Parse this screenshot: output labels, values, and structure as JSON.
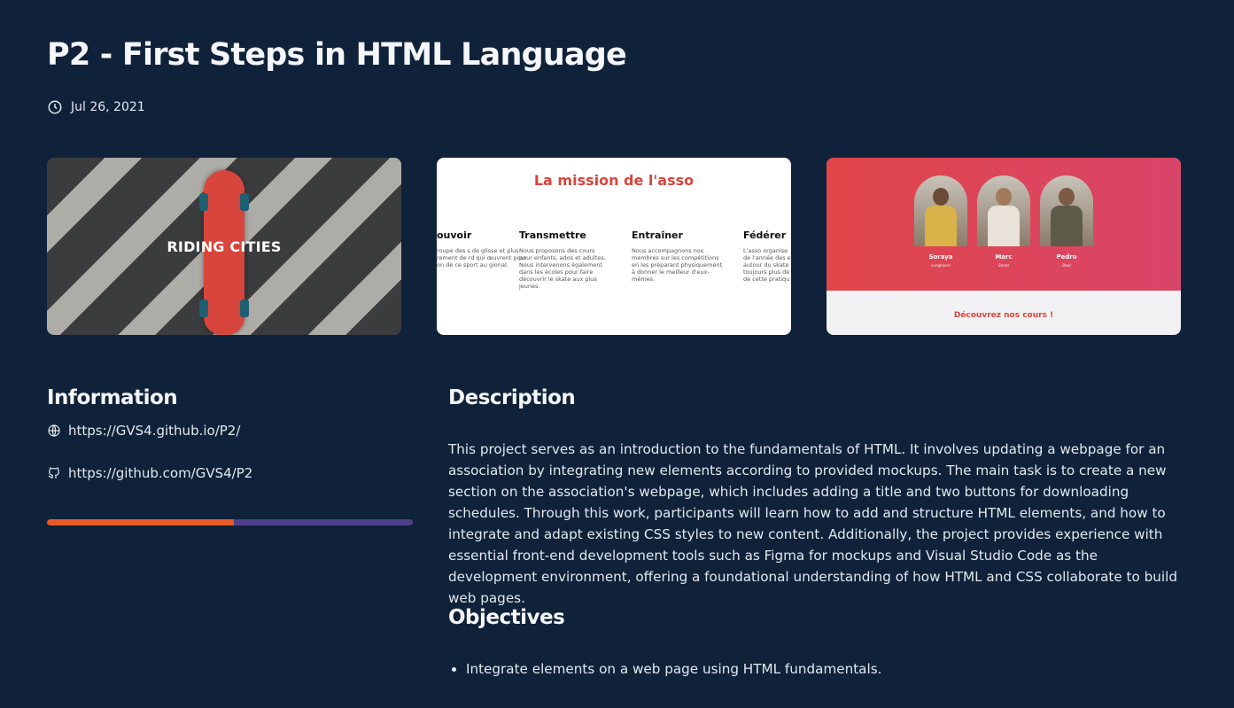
{
  "project": {
    "title": "P2 - First Steps in HTML Language",
    "date": "Jul 26, 2021"
  },
  "thumbnails": {
    "first": {
      "brand": "RIDING CITIES"
    },
    "second": {
      "heading": "La mission de l'asso",
      "columns": [
        {
          "title": "ouvoir",
          "text": "roupe des s de glisse et plus rement de rd qui œuvrent pour on de ce sport au gional."
        },
        {
          "title": "Transmettre",
          "text": "Nous proposons des cours pour enfants, ados et adultes. Nous intervenons également dans les écoles pour faire découvrir le skate aux plus jeunes."
        },
        {
          "title": "Entraîner",
          "text": "Nous accompagnons nos membres sur les compétitions en les préparant physiquement à donner le meilleur d'eux-mêmes."
        },
        {
          "title": "Fédérer",
          "text": "L'asso organise de l'année des e autour du skate toujours plus de de cette pratiqu"
        }
      ]
    },
    "third": {
      "people": [
        {
          "name": "Soraya",
          "role": "Longboard"
        },
        {
          "name": "Marc",
          "role": "Street"
        },
        {
          "name": "Pedro",
          "role": "Bowl"
        }
      ],
      "cta": "Découvrez nos cours !"
    }
  },
  "information": {
    "title": "Information",
    "website": "https://GVS4.github.io/P2/",
    "repository": "https://github.com/GVS4/P2",
    "progress_fraction": 0.51,
    "progress_colors": {
      "filled": "#ea5a25",
      "rest": "#4f3f88"
    }
  },
  "description": {
    "title": "Description",
    "text": "This project serves as an introduction to the fundamentals of HTML. It involves updating a webpage for an association by integrating new elements according to provided mockups. The main task is to create a new section on the association's webpage, which includes adding a title and two buttons for downloading schedules. Through this work, participants will learn how to add and structure HTML elements, and how to integrate and adapt existing CSS styles to new content. Additionally, the project provides experience with essential front-end development tools such as Figma for mockups and Visual Studio Code as the development environment, offering a foundational understanding of how HTML and CSS collaborate to build web pages."
  },
  "objectives": {
    "title": "Objectives",
    "items": [
      "Integrate elements on a web page using HTML fundamentals."
    ]
  },
  "icons": {
    "date": "clock-icon",
    "website": "globe-icon",
    "repository": "github-icon"
  },
  "colors": {
    "background": "#0f2239",
    "accent_red": "#d8453c"
  }
}
